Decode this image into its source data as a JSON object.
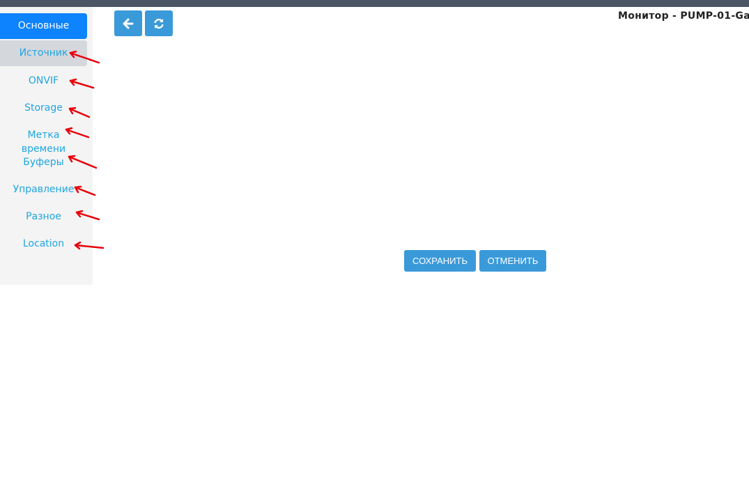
{
  "header": {
    "title": "Монитор - PUMP-01-Ga"
  },
  "toolbar": {
    "back_icon": "arrow-left-icon",
    "refresh_icon": "refresh-icon"
  },
  "sidebar": {
    "items": [
      {
        "label": "Основные",
        "state": "active"
      },
      {
        "label": "Источник",
        "state": "selected"
      },
      {
        "label": "ONVIF"
      },
      {
        "label": "Storage"
      },
      {
        "label_line1": "Метка",
        "label_line2": "времени"
      },
      {
        "label": "Буферы"
      },
      {
        "label": "Управление"
      },
      {
        "label": "Разное"
      },
      {
        "label": "Location"
      }
    ]
  },
  "actions": {
    "save_label": "СОХРАНИТЬ",
    "cancel_label": "ОТМЕНИТЬ"
  },
  "colors": {
    "topbar": "#4b5563",
    "sidebar_bg": "#f4f4f4",
    "active_tab": "#0d83fd",
    "selected_tab": "#d4d7db",
    "link": "#1fa6e0",
    "button": "#3a9ad9",
    "annotation_arrow": "#e8000b"
  }
}
